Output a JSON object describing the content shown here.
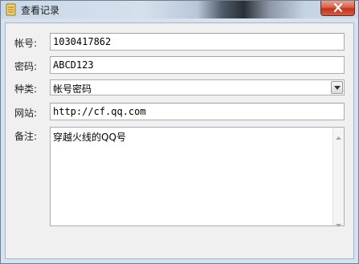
{
  "window": {
    "title": "查看记录"
  },
  "form": {
    "account": {
      "label": "帐号:",
      "value": "1030417862"
    },
    "password": {
      "label": "密码:",
      "value": "ABCD123"
    },
    "category": {
      "label": "种类:",
      "value": "帐号密码"
    },
    "website": {
      "label": "网站:",
      "value": "http://cf.qq.com"
    },
    "note": {
      "label": "备注:",
      "value": "穿越火线的QQ号"
    }
  },
  "icons": {
    "title": "notebook-icon",
    "close": "close-icon",
    "dropdown": "chevron-down-icon",
    "scroll_up": "scroll-up-arrow-icon",
    "scroll_down": "scroll-down-arrow-icon"
  },
  "colors": {
    "close_button": "#c2331b",
    "field_border": "#abadb3",
    "background": "#f0f0f0"
  }
}
